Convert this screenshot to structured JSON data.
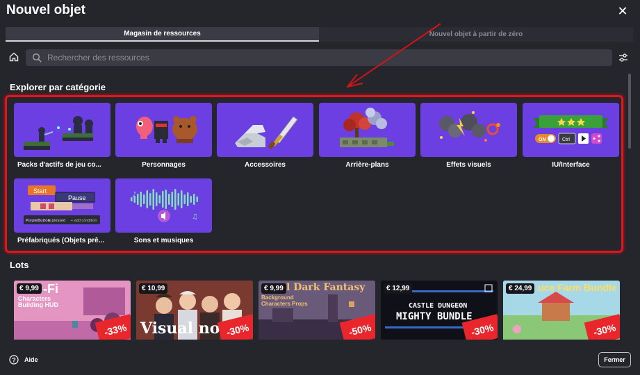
{
  "dialog": {
    "title": "Nouvel objet",
    "close_glyph": "✕"
  },
  "tabs": [
    {
      "label": "Magasin de ressources",
      "active": true
    },
    {
      "label": "Nouvel objet à partir de zéro",
      "active": false
    }
  ],
  "search": {
    "placeholder": "Rechercher des ressources"
  },
  "sections": {
    "categories_title": "Explorer par catégorie",
    "bundles_title": "Lots"
  },
  "categories": [
    {
      "label": "Packs d'actifs de jeu co...",
      "icon": "game-asset-pack-icon"
    },
    {
      "label": "Personnages",
      "icon": "characters-icon"
    },
    {
      "label": "Accessoires",
      "icon": "sword-props-icon"
    },
    {
      "label": "Arrière-plans",
      "icon": "background-tree-icon"
    },
    {
      "label": "Effets visuels",
      "icon": "visual-effects-icon"
    },
    {
      "label": "IU/Interface",
      "icon": "ui-interface-icon"
    },
    {
      "label": "Préfabriqués (Objets prê...",
      "icon": "prefab-objects-icon"
    },
    {
      "label": "Sons et musiques",
      "icon": "sound-wave-icon"
    }
  ],
  "category_art": {
    "prefab_start": "Start",
    "prefab_pause": "Pause",
    "prefab_condition_name": "PurpleButton",
    "prefab_condition_text": "is pressed",
    "prefab_add_condition": "+ add condition",
    "ui_ctrl": "Ctrl",
    "ui_toggle": "ON"
  },
  "bundles": [
    {
      "price": "€ 9,99",
      "title": "-Fi",
      "subtitle": "Characters Building HUD",
      "discount": "-33%"
    },
    {
      "price": "€ 10,99",
      "title": "Visual novel",
      "subtitle": "",
      "discount": "-30%"
    },
    {
      "price": "€ 9,99",
      "title": "l Dark Fantasy",
      "subtitle": "Background Characters Props",
      "discount": "-50%"
    },
    {
      "price": "€ 12,99",
      "title": "CASTLE DUNGEON",
      "subtitle": "MIGHTY BUNDLE",
      "discount": "-30%"
    },
    {
      "price": "€ 24,99",
      "title": "uce Farm Bundle",
      "subtitle": "",
      "discount": "-30%"
    }
  ],
  "footer": {
    "help_label": "Aide",
    "close_label": "Fermer"
  },
  "colors": {
    "background": "#25252c",
    "card_purple": "#6b3fe2",
    "highlight_red": "#e4141b",
    "discount_red": "#e8262c"
  }
}
